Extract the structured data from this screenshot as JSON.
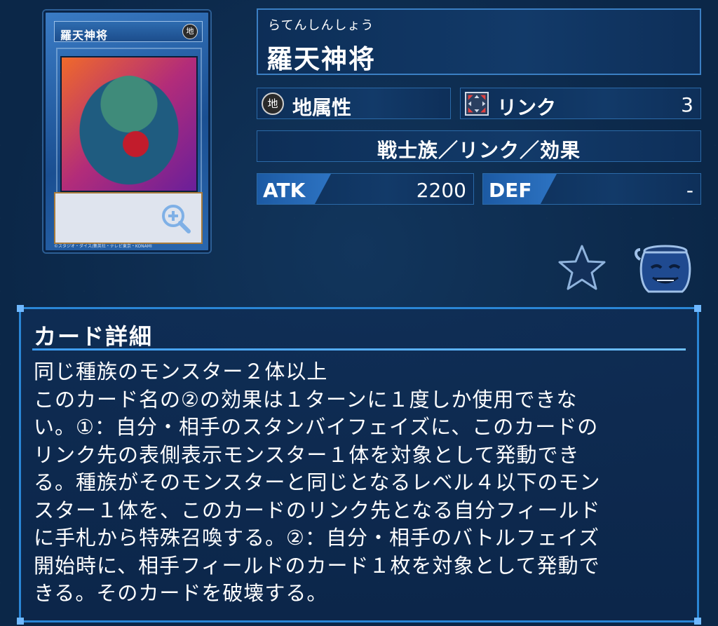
{
  "card": {
    "frame_name": "羅天神将",
    "attribute_glyph": "地",
    "copyright": "©スタジオ・ダイス/集英社・テレビ東京・KONAMI"
  },
  "name_panel": {
    "reading": "らてんしんしょう",
    "name": "羅天神将"
  },
  "attribute": {
    "icon_glyph": "地",
    "label": "地属性"
  },
  "link": {
    "label": "リンク",
    "value": "3"
  },
  "type_line": "戦士族／リンク／効果",
  "atk": {
    "label": "ATK",
    "value": "2200"
  },
  "def": {
    "label": "DEF",
    "value": "-"
  },
  "detail": {
    "title": "カード詳細",
    "lines": [
      "同じ種族のモンスター２体以上",
      "このカード名の②の効果は１ターンに１度しか使用できな",
      "い。①：自分・相手のスタンバイフェイズに、このカードの",
      "リンク先の表側表示モンスター１体を対象として発動でき",
      "る。種族がそのモンスターと同じとなるレベル４以下のモン",
      "スター１体を、このカードのリンク先となる自分フィールド",
      "に手札から特殊召喚する。②：自分・相手のバトルフェイズ",
      "開始時に、相手フィールドのカード１枚を対象として発動で",
      "きる。そのカードを破壊する。"
    ]
  },
  "colors": {
    "background": "#0b2748",
    "panel_border": "#2b6aa8",
    "detail_border": "#2a86d6",
    "stat_label": "#2d73c2"
  }
}
